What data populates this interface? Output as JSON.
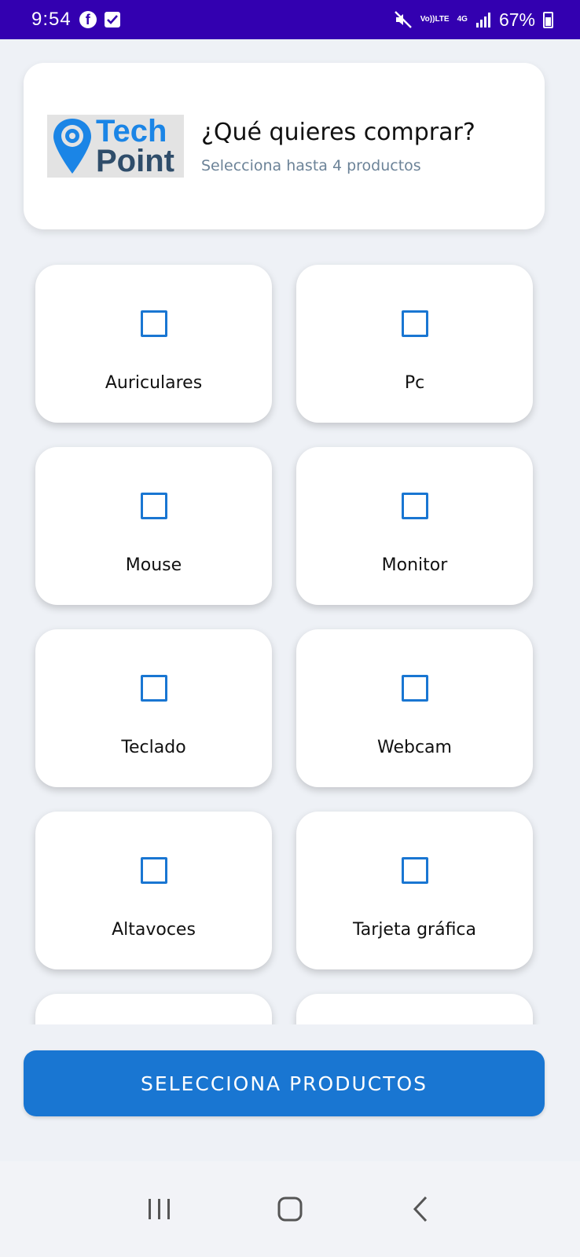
{
  "status_bar": {
    "time": "9:54",
    "network_top": "Vo))",
    "network_bottom": "LTE",
    "network_type": "4G",
    "battery": "67%",
    "icons": [
      "facebook-icon",
      "check-notification-icon",
      "mute-icon",
      "signal-icon",
      "battery-icon"
    ]
  },
  "header": {
    "logo_line1": "Tech",
    "logo_line2": "Point",
    "title": "¿Qué quieres comprar?",
    "subtitle": "Selecciona hasta 4 productos"
  },
  "products": [
    {
      "label": "Auriculares",
      "checked": false
    },
    {
      "label": "Pc",
      "checked": false
    },
    {
      "label": "Mouse",
      "checked": false
    },
    {
      "label": "Monitor",
      "checked": false
    },
    {
      "label": "Teclado",
      "checked": false
    },
    {
      "label": "Webcam",
      "checked": false
    },
    {
      "label": "Altavoces",
      "checked": false
    },
    {
      "label": "Tarjeta gráfica",
      "checked": false
    },
    {
      "label": "",
      "checked": false
    },
    {
      "label": "",
      "checked": false
    }
  ],
  "action": {
    "button_label": "SELECCIONA PRODUCTOS"
  },
  "colors": {
    "status_bar": "#3300b0",
    "accent": "#1976d2",
    "background": "#eef1f6"
  }
}
